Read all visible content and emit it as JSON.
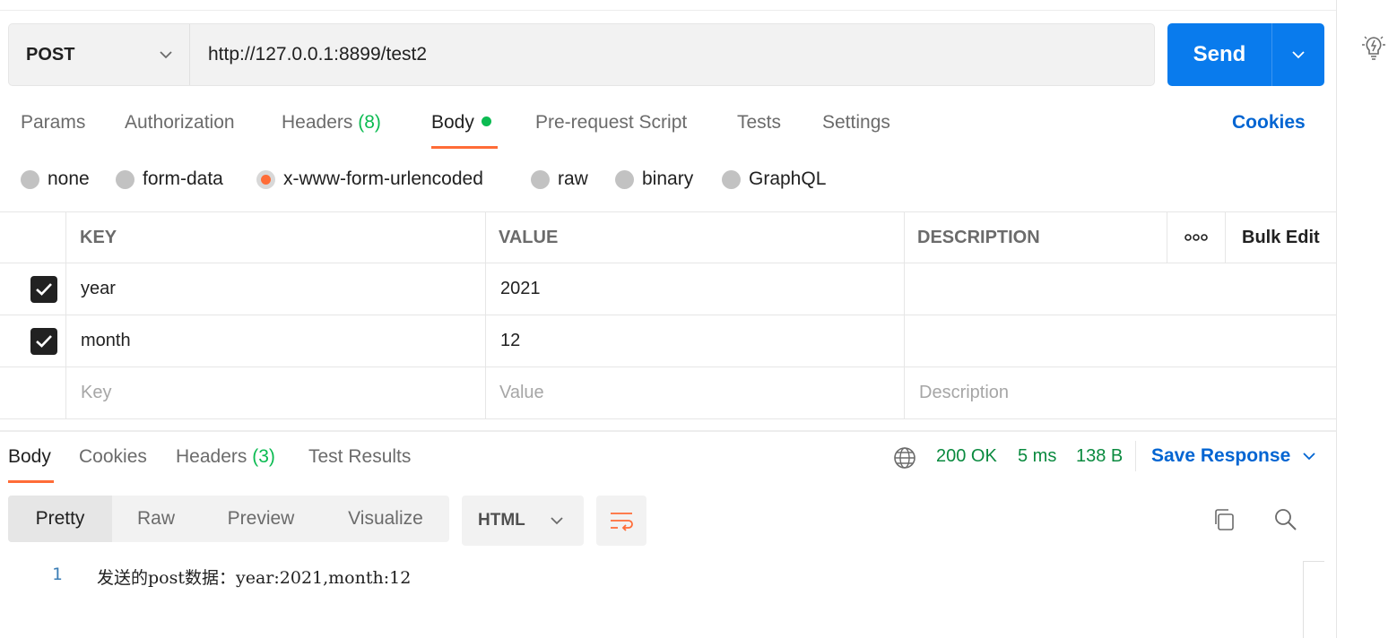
{
  "request": {
    "method": "POST",
    "url": "http://127.0.0.1:8899/test2",
    "send_label": "Send"
  },
  "request_tabs": [
    {
      "label": "Params"
    },
    {
      "label": "Authorization"
    },
    {
      "label": "Headers",
      "count": "(8)"
    },
    {
      "label": "Body"
    },
    {
      "label": "Pre-request Script"
    },
    {
      "label": "Tests"
    },
    {
      "label": "Settings"
    }
  ],
  "active_request_tab": "Body",
  "cookies_link": "Cookies",
  "body_types": [
    {
      "label": "none",
      "selected": false
    },
    {
      "label": "form-data",
      "selected": false
    },
    {
      "label": "x-www-form-urlencoded",
      "selected": true
    },
    {
      "label": "raw",
      "selected": false
    },
    {
      "label": "binary",
      "selected": false
    },
    {
      "label": "GraphQL",
      "selected": false
    }
  ],
  "table": {
    "headers": {
      "key": "KEY",
      "value": "VALUE",
      "description": "DESCRIPTION",
      "more": "ooo",
      "bulk_edit": "Bulk Edit"
    },
    "rows": [
      {
        "checked": true,
        "key": "year",
        "value": "2021",
        "description": ""
      },
      {
        "checked": true,
        "key": "month",
        "value": "12",
        "description": ""
      }
    ],
    "placeholders": {
      "key": "Key",
      "value": "Value",
      "description": "Description"
    }
  },
  "response": {
    "tabs": [
      {
        "label": "Body"
      },
      {
        "label": "Cookies"
      },
      {
        "label": "Headers",
        "count": "(3)"
      },
      {
        "label": "Test Results"
      }
    ],
    "status": "200 OK",
    "time": "5 ms",
    "size": "138 B",
    "save_response": "Save Response",
    "views": [
      "Pretty",
      "Raw",
      "Preview",
      "Visualize"
    ],
    "active_view": "Pretty",
    "format": "HTML",
    "code_lines": [
      {
        "num": "1",
        "text": "发送的post数据：year:2021,month:12"
      }
    ]
  },
  "colors": {
    "accent_orange": "#ff6c37",
    "send_blue": "#097bed",
    "link_blue": "#0265d2",
    "status_green": "#0a8a3f"
  }
}
